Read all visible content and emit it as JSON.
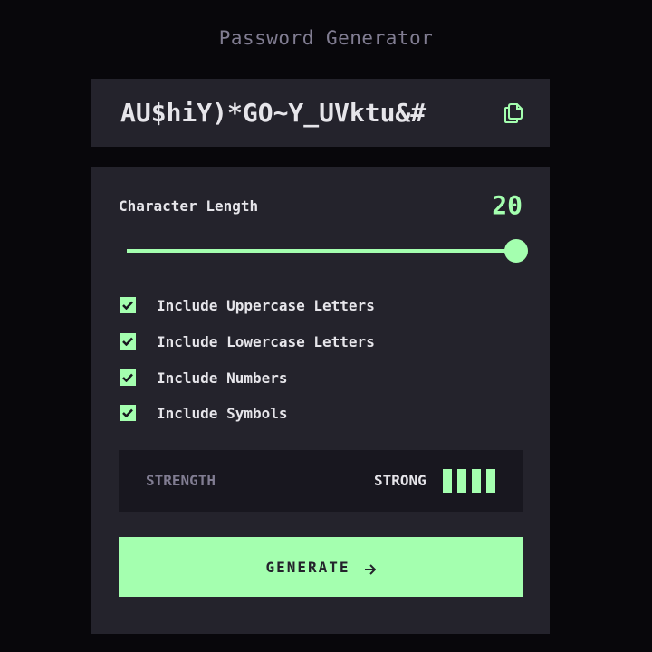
{
  "title": "Password Generator",
  "password": {
    "value": "AU$hiY)*GO~Y_UVktu&#",
    "copy_icon": "copy-icon"
  },
  "length": {
    "label": "Character Length",
    "value": "20",
    "slider_fraction": 1.0
  },
  "options": [
    {
      "label": "Include Uppercase Letters",
      "checked": true
    },
    {
      "label": "Include Lowercase Letters",
      "checked": true
    },
    {
      "label": "Include Numbers",
      "checked": true
    },
    {
      "label": "Include Symbols",
      "checked": true
    }
  ],
  "strength": {
    "label": "STRENGTH",
    "value": "STRONG",
    "level": 4,
    "max_level": 4
  },
  "generate": {
    "label": "GENERATE",
    "icon": "arrow-right-icon"
  },
  "colors": {
    "accent": "#a4ffaf",
    "card": "#24232c",
    "background": "#08070b",
    "muted": "#817d92",
    "text": "#e6e5ea"
  }
}
